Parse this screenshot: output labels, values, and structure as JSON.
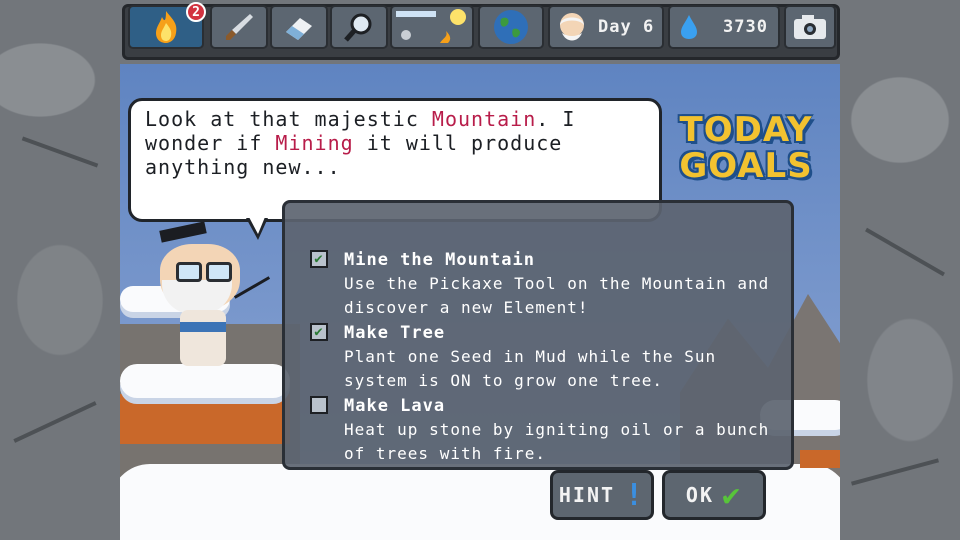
{
  "toolbar": {
    "fire_badge": "2",
    "day_label": "Day 6",
    "mana_value": "3730",
    "icons": [
      "fire-icon",
      "brush-icon",
      "eraser-icon",
      "magnifier-icon",
      "sun-system-icon",
      "planet-icon",
      "professor-icon",
      "mana-drop-icon",
      "camera-icon"
    ]
  },
  "dialog": {
    "parts": [
      {
        "text": "Look at that majestic ",
        "highlight": false
      },
      {
        "text": "Mountain",
        "highlight": true
      },
      {
        "text": ". I wonder if ",
        "highlight": false
      },
      {
        "text": "Mining",
        "highlight": true
      },
      {
        "text": " it will produce anything new...",
        "highlight": false
      }
    ],
    "highlight_color": "#b81d4a"
  },
  "goals": {
    "title_line1": "TODAY",
    "title_line2": "GOALS",
    "items": [
      {
        "title": "Mine the Mountain",
        "desc": "Use the Pickaxe Tool on the Mountain and discover a new Element!",
        "done": true
      },
      {
        "title": "Make Tree",
        "desc": "Plant one Seed in Mud while the Sun system is ON to grow one tree.",
        "done": true
      },
      {
        "title": "Make Lava",
        "desc": "Heat up stone by igniting oil or a bunch of trees with fire.",
        "done": false
      }
    ],
    "check_mark": "✔"
  },
  "buttons": {
    "hint": "HINT",
    "hint_mark": "!",
    "ok": "OK",
    "ok_mark": "✔"
  },
  "colors": {
    "accent": "#f2c230",
    "check_green": "#58c43a",
    "hint_blue": "#3b8fe0"
  }
}
